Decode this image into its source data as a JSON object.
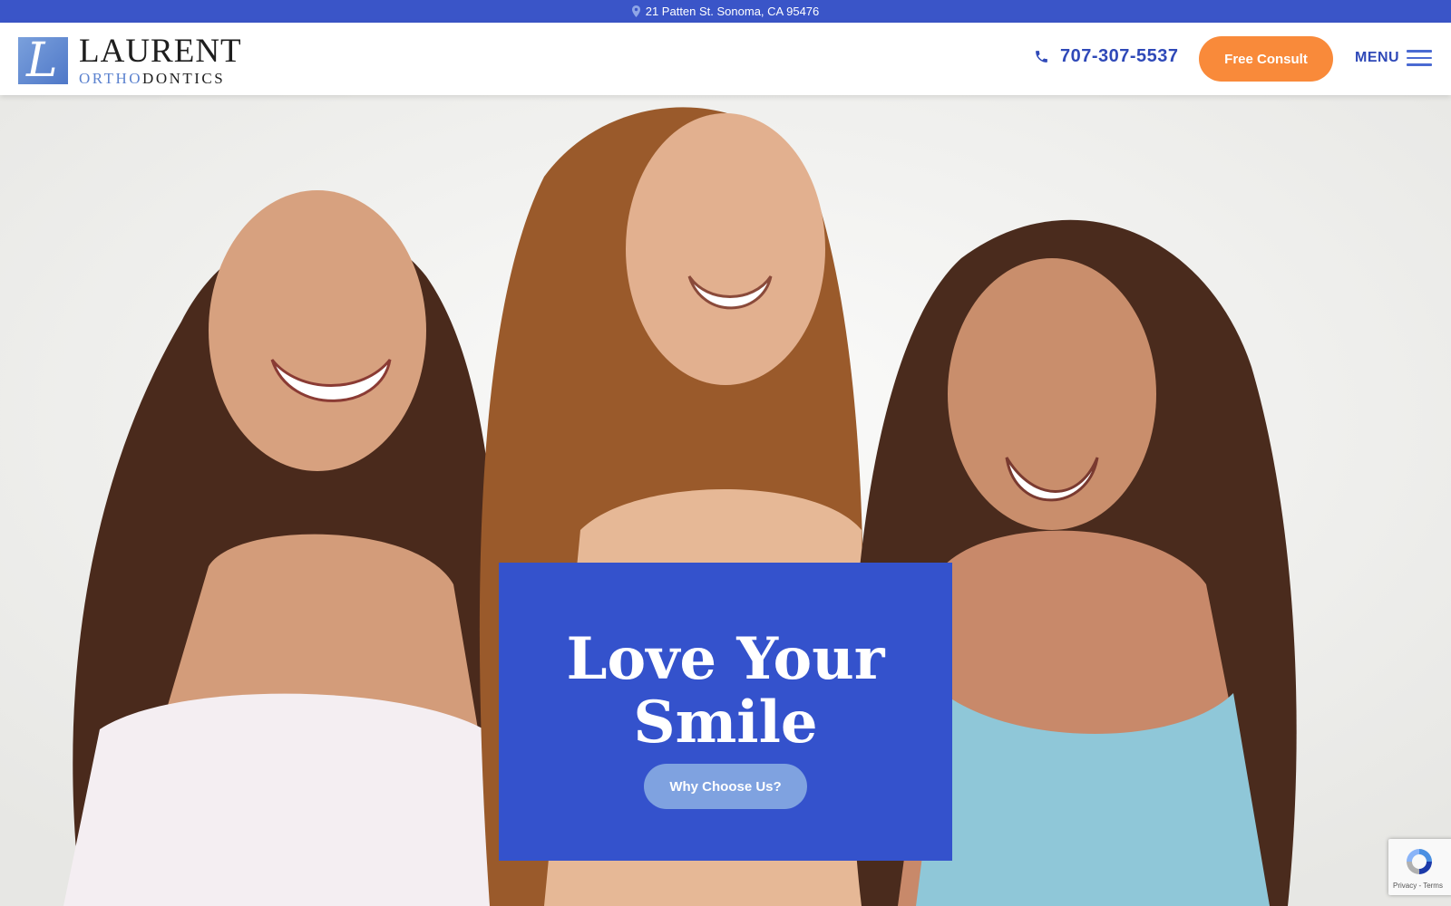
{
  "topbar": {
    "address": "21 Patten St. Sonoma, CA 95476",
    "icon": "map-pin-icon"
  },
  "header": {
    "logo": {
      "monogram": "L",
      "line1": "LAURENT",
      "line2_part1": "ORTHO",
      "line2_part2": "DONTICS"
    },
    "phone": {
      "number": "707-307-5537",
      "icon": "phone-icon"
    },
    "consult_button": "Free Consult",
    "menu_label": "MENU",
    "menu_icon": "hamburger-icon"
  },
  "hero": {
    "image": "three-smiling-teen-girls-photo",
    "title_line1": "Love Your",
    "title_line2": "Smile",
    "cta_button": "Why Choose Us?"
  },
  "recaptcha": {
    "icon": "recaptcha-icon",
    "footer_text": "Privacy - Terms"
  },
  "colors": {
    "brand_blue": "#3452cc",
    "topbar_blue": "#3a55c8",
    "accent_orange": "#f98a3a",
    "light_blue_button": "#7fa2e0",
    "text_blue": "#2f49b8"
  }
}
